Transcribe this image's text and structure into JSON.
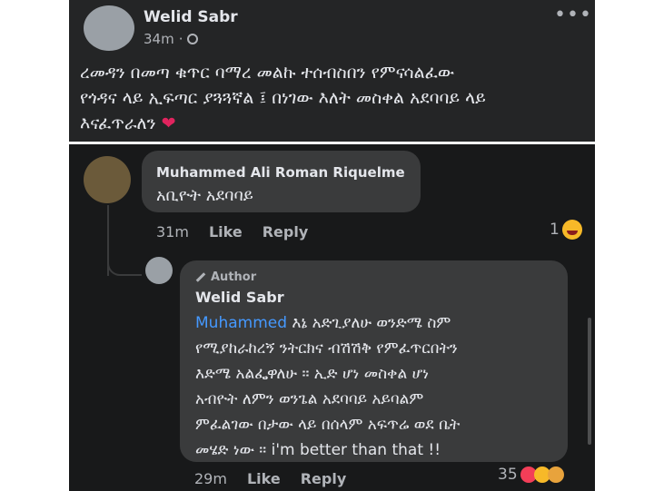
{
  "post": {
    "author": "Welid Sabr",
    "time": "34m",
    "more_label": "•••",
    "text_lines": [
      "ረመዳን በመጣ ቁጥር ባማረ መልኩ ተሰብስበን የምናሳልፈው",
      "የጎዳና ላይ ኢፍጣር ያጓጓኛል ፤ በነገው እለት መስቀል አደባባይ ላይ",
      "እናፈጥራለን"
    ],
    "heart": "❤"
  },
  "comment1": {
    "author": "Muhammed Ali Roman Riquelme",
    "text": "አቢዮት አደባባይ",
    "time": "31m",
    "like_label": "Like",
    "reply_label": "Reply",
    "reaction_count": "1"
  },
  "comment2": {
    "badge": "Author",
    "author": "Welid Sabr",
    "mention": "Muhammed",
    "text_line1": " እኔ አድጊያለሁ ወንድሜ ስም",
    "text_lines": [
      "የሚያከራከረኝ ንትርክና ብሽሽቅ የምፈጥርበትን",
      "እድሜ አልፌዋለሁ ። ኢድ ሆነ መስቀል ሆነ",
      "አብዮት ለምን ወንጌል አደባባይ አይባልም",
      "ምፈልገው በታው ላይ በሰላም አፍጥሬ ወደ ቤት",
      "መሄድ ነው ። i'm better than that !!"
    ],
    "time": "29m",
    "like_label": "Like",
    "reply_label": "Reply",
    "reaction_count": "35"
  },
  "colors": {
    "accent": "#4599ff",
    "panel": "#242526",
    "bubble": "#3a3b3c"
  }
}
